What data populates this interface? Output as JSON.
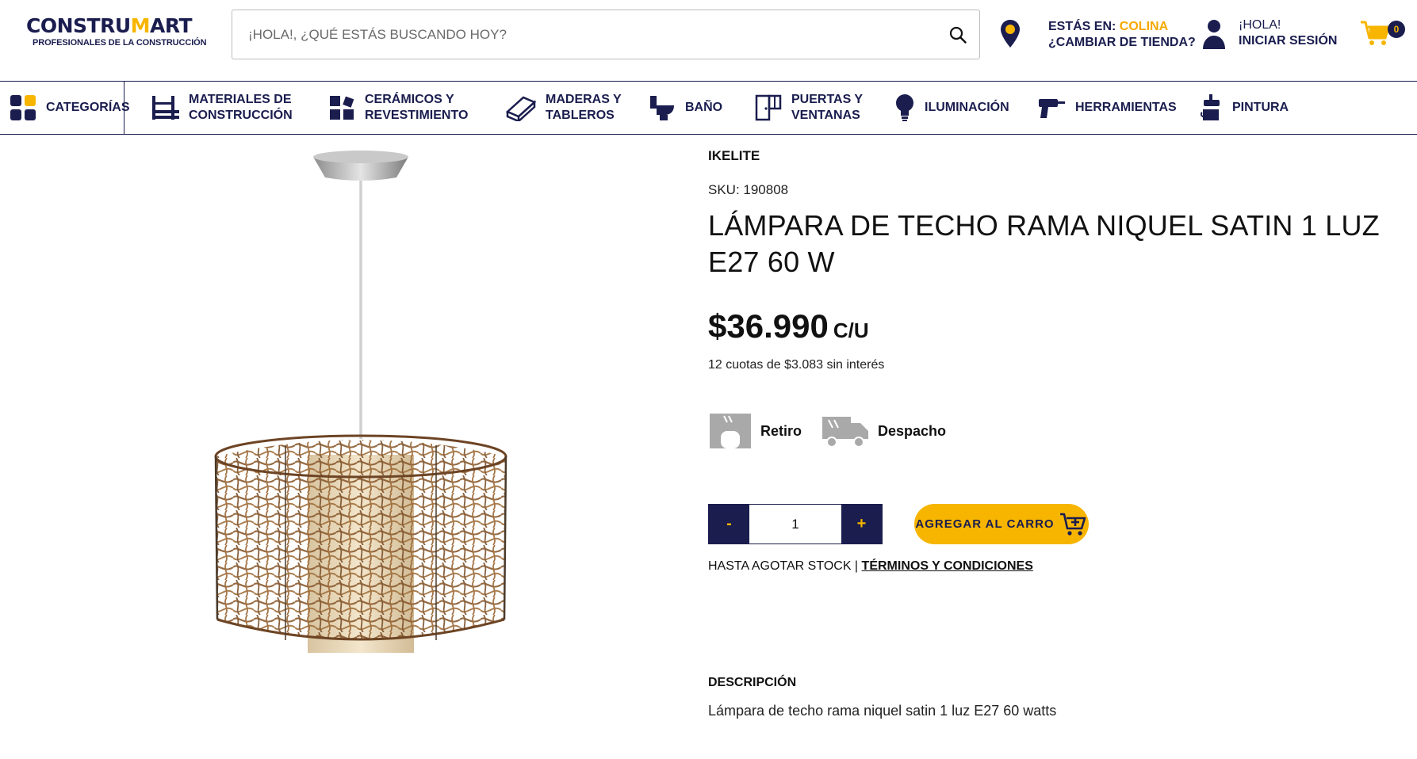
{
  "header": {
    "logo": {
      "main_a": "CONSTRU",
      "main_b": "M",
      "main_c": "ART",
      "subtitle": "PROFESIONALES DE LA CONSTRUCCIÓN"
    },
    "search": {
      "placeholder": "¡HOLA!, ¿QUÉ ESTÁS BUSCANDO HOY?",
      "value": ""
    },
    "store": {
      "prefix": "ESTÁS EN:",
      "city": "COLINA",
      "change": "¿CAMBIAR DE TIENDA?"
    },
    "login": {
      "greeting": "¡HOLA!",
      "action": "INICIAR SESIÓN"
    },
    "cart": {
      "count": "0"
    }
  },
  "nav": {
    "items": [
      {
        "label": "CATEGORÍAS",
        "icon": "grid-icon"
      },
      {
        "label_1": "MATERIALES DE",
        "label_2": "CONSTRUCCIÓN",
        "icon": "bricks-icon"
      },
      {
        "label_1": "CERÁMICOS Y",
        "label_2": "REVESTIMIENTO",
        "icon": "tiles-icon"
      },
      {
        "label_1": "MADERAS Y",
        "label_2": "TABLEROS",
        "icon": "wood-icon"
      },
      {
        "label": "BAÑO",
        "icon": "toilet-icon"
      },
      {
        "label_1": "PUERTAS Y",
        "label_2": "VENTANAS",
        "icon": "door-icon"
      },
      {
        "label": "ILUMINACIÓN",
        "icon": "bulb-icon"
      },
      {
        "label": "HERRAMIENTAS",
        "icon": "drill-icon"
      },
      {
        "label": "PINTURA",
        "icon": "paint-icon"
      }
    ]
  },
  "product": {
    "brand": "IKELITE",
    "sku": "SKU: 190808",
    "title": "LÁMPARA DE TECHO RAMA NIQUEL SATIN 1 LUZ E27 60 W",
    "price": "$36.990",
    "price_unit": "C/U",
    "installments": "12 cuotas de $3.083 sin interés",
    "delivery": {
      "pickup": "Retiro",
      "shipping": "Despacho"
    },
    "quantity": {
      "minus": "-",
      "value": "1",
      "plus": "+"
    },
    "add_to_cart": "AGREGAR AL CARRO",
    "stock_text": "HASTA AGOTAR STOCK |",
    "terms": "TÉRMINOS Y CONDICIONES",
    "description_heading": "DESCRIPCIÓN",
    "description": "Lámpara de techo rama niquel satin 1 luz E27 60 watts"
  },
  "colors": {
    "navy": "#1a1d4e",
    "yellow": "#f7b500",
    "gray_icon": "#a9a9a9"
  }
}
